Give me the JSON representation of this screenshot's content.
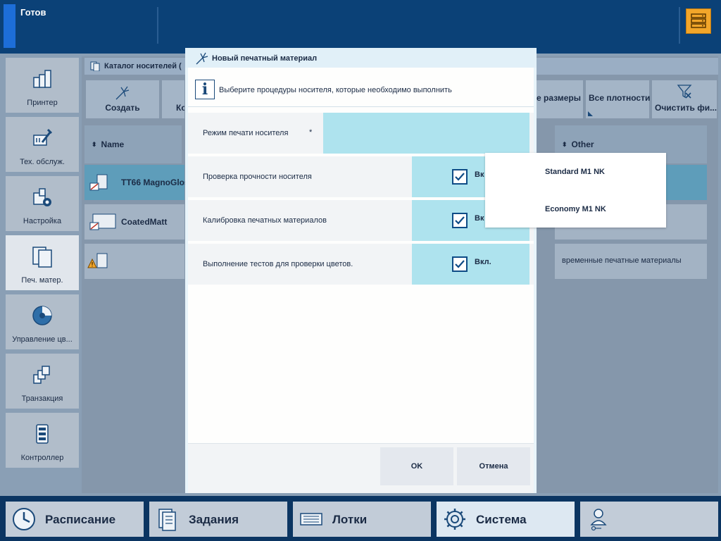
{
  "status": {
    "text": "Готов"
  },
  "nav": {
    "printer": "Принтер",
    "maintenance": "Тех. обслуж.",
    "settings": "Настройка",
    "media": "Печ. матер.",
    "color": "Управление цв...",
    "transaction": "Транзакция",
    "controller": "Контроллер"
  },
  "catalog": {
    "title": "Каталог носителей ("
  },
  "toolbar": {
    "create": "Создать",
    "partial": "Ко",
    "sizes": "е размеры",
    "weights": "Все плотности",
    "clear": "Очистить фи..."
  },
  "table": {
    "col_name": "Name",
    "col_other": "Other",
    "rows": [
      {
        "name": "TT66 MagnoGlos",
        "other": ""
      },
      {
        "name": "CoatedMatt",
        "other": ""
      },
      {
        "name": "",
        "other": "временные печатные материалы"
      }
    ]
  },
  "dialog": {
    "title": "Новый печатный материал",
    "info": "Выберите процедуры носителя, которые необходимо выполнить",
    "info_glyph": "i",
    "mode_label": "Режим печати носителя",
    "required_mark": "*",
    "rows": [
      {
        "label": "Проверка прочности носителя",
        "value": "Вк",
        "checked": true
      },
      {
        "label": "Калибровка печатных материалов",
        "value": "Вк",
        "checked": true
      },
      {
        "label": "Выполнение тестов для проверки цветов.",
        "value": "Вкл.",
        "checked": true
      }
    ],
    "ok": "OK",
    "cancel": "Отмена"
  },
  "dropdown": {
    "options": [
      "Standard M1 NK",
      "Economy M1 NK"
    ]
  },
  "bottom_nav": {
    "schedule": "Расписание",
    "jobs": "Задания",
    "trays": "Лотки",
    "system": "Система"
  },
  "colors": {
    "top_bar": "#0b4177",
    "accent": "#1d6ed8",
    "server_icon": "#f2a62a",
    "selected_row": "#5e9dba",
    "value_cell": "#aee3ee",
    "checkbox_border": "#0e4c86"
  },
  "icons": {
    "server": "server-status-icon",
    "printer": "printer-icon",
    "maintenance": "wrench-icon",
    "settings": "settings-gear-icon",
    "media": "media-icon",
    "color": "color-wheel-icon",
    "transaction": "transaction-icon",
    "controller": "controller-icon",
    "create": "sparkle-icon",
    "clear_filter": "clear-filter-icon",
    "sort": "sort-arrows-icon",
    "warning": "warning-icon",
    "info": "info-icon",
    "checkbox": "check-icon",
    "schedule": "clock-icon",
    "jobs": "document-icon",
    "trays": "tray-icon",
    "system": "gear-icon",
    "user": "user-key-icon"
  }
}
